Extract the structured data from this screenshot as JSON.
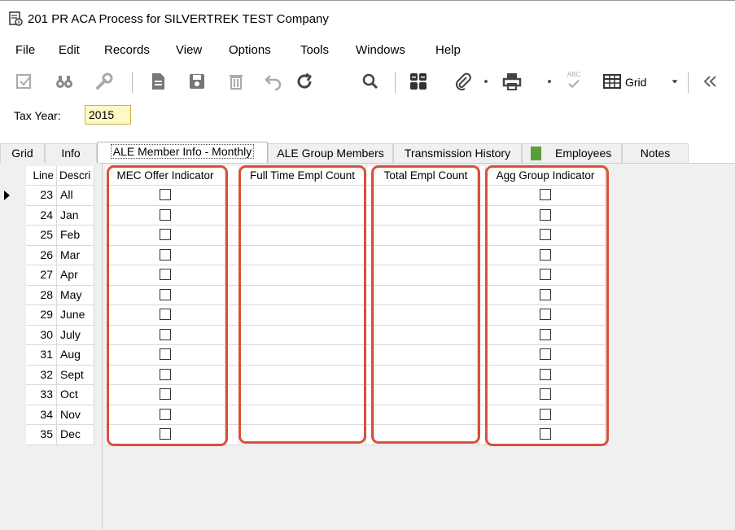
{
  "window": {
    "title": "201 PR ACA Process for SILVERTREK TEST Company"
  },
  "menu": [
    "File",
    "Edit",
    "Records",
    "View",
    "Options",
    "Tools",
    "Windows",
    "Help"
  ],
  "toolbar": {
    "icons": [
      "checkbox-edit-icon",
      "binoculars-icon",
      "wrench-icon",
      "new-document-icon",
      "save-icon",
      "delete-icon",
      "undo-icon",
      "refresh-icon",
      "search-icon",
      "calculator-icon",
      "paperclip-icon",
      "print-icon",
      "spellcheck-icon",
      "grid-icon",
      "collapse-icon"
    ],
    "grid_label": "Grid",
    "spell_label": "ABC"
  },
  "taxyear": {
    "label": "Tax Year:",
    "value": "2015"
  },
  "tabs": [
    "Grid",
    "Info",
    "ALE Member Info - Monthly",
    "ALE Group Members",
    "Transmission History",
    "Employees",
    "Notes"
  ],
  "grid": {
    "columns": {
      "line": "Line",
      "desc": "Descri",
      "mec": "MEC Offer Indicator",
      "fte": "Full Time Empl Count",
      "total": "Total Empl Count",
      "agg": "Agg Group Indicator"
    },
    "rows": [
      {
        "line": "23",
        "desc": "All"
      },
      {
        "line": "24",
        "desc": "Jan"
      },
      {
        "line": "25",
        "desc": "Feb"
      },
      {
        "line": "26",
        "desc": "Mar"
      },
      {
        "line": "27",
        "desc": "Apr"
      },
      {
        "line": "28",
        "desc": "May"
      },
      {
        "line": "29",
        "desc": "June"
      },
      {
        "line": "30",
        "desc": "July"
      },
      {
        "line": "31",
        "desc": "Aug"
      },
      {
        "line": "32",
        "desc": "Sept"
      },
      {
        "line": "33",
        "desc": "Oct"
      },
      {
        "line": "34",
        "desc": "Nov"
      },
      {
        "line": "35",
        "desc": "Dec"
      }
    ]
  },
  "colors": {
    "highlight": "#d9503a",
    "input_bg": "#fff8c4"
  }
}
